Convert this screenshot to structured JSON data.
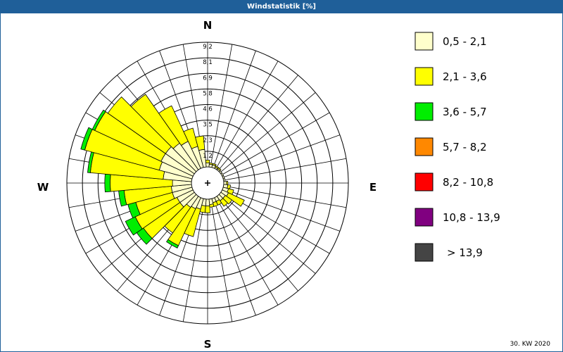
{
  "window": {
    "title": "Windstatistik [%]"
  },
  "footer": {
    "week": "30. KW 2020"
  },
  "chart_data": {
    "type": "wind-rose",
    "title": "Windstatistik [%]",
    "unit": "%",
    "directions": [
      "N",
      "E",
      "S",
      "W"
    ],
    "radial_ticks": [
      "1,2",
      "2,3",
      "3,5",
      "4,6",
      "5,8",
      "6,9",
      "8,1",
      "9,2"
    ],
    "rmax": 9.2,
    "sector_count": 36,
    "legend": [
      {
        "label": "0,5 - 2,1",
        "color": "#ffffcc"
      },
      {
        "label": "2,1 - 3,6",
        "color": "#ffff00"
      },
      {
        "label": "3,6 - 5,7",
        "color": "#00ee00"
      },
      {
        "label": "5,7 - 8,2",
        "color": "#ff8800"
      },
      {
        "label": "8,2 - 10,8",
        "color": "#ff0000"
      },
      {
        "label": "10,8 - 13,9",
        "color": "#800080"
      },
      {
        "label": "> 13,9",
        "color": "#444444"
      }
    ],
    "sectors": [
      {
        "dir": 0,
        "values": [
          0.3,
          0.2,
          0,
          0,
          0,
          0,
          0
        ]
      },
      {
        "dir": 10,
        "values": [
          0.2,
          0.1,
          0,
          0,
          0,
          0,
          0
        ]
      },
      {
        "dir": 20,
        "values": [
          0.2,
          0.1,
          0,
          0,
          0,
          0,
          0
        ]
      },
      {
        "dir": 30,
        "values": [
          0.1,
          0.1,
          0,
          0,
          0,
          0,
          0
        ]
      },
      {
        "dir": 40,
        "values": [
          0.1,
          0.1,
          0,
          0,
          0,
          0,
          0
        ]
      },
      {
        "dir": 50,
        "values": [
          0.1,
          0,
          0,
          0,
          0,
          0,
          0
        ]
      },
      {
        "dir": 60,
        "values": [
          0.1,
          0,
          0,
          0,
          0,
          0,
          0
        ]
      },
      {
        "dir": 70,
        "values": [
          0.1,
          0,
          0,
          0,
          0,
          0,
          0
        ]
      },
      {
        "dir": 80,
        "values": [
          0.1,
          0,
          0,
          0,
          0,
          0,
          0
        ]
      },
      {
        "dir": 90,
        "values": [
          0.2,
          0.1,
          0,
          0,
          0,
          0,
          0
        ]
      },
      {
        "dir": 100,
        "values": [
          0.3,
          0.2,
          0,
          0,
          0,
          0,
          0
        ]
      },
      {
        "dir": 110,
        "values": [
          0.4,
          0.4,
          0,
          0,
          0,
          0,
          0
        ]
      },
      {
        "dir": 120,
        "values": [
          0.5,
          1.3,
          0,
          0,
          0,
          0,
          0
        ]
      },
      {
        "dir": 130,
        "values": [
          0.4,
          0.6,
          0,
          0,
          0,
          0,
          0
        ]
      },
      {
        "dir": 140,
        "values": [
          0.4,
          0.5,
          0,
          0,
          0,
          0,
          0
        ]
      },
      {
        "dir": 150,
        "values": [
          0.3,
          0.3,
          0,
          0,
          0,
          0,
          0
        ]
      },
      {
        "dir": 160,
        "values": [
          0.3,
          0.3,
          0,
          0,
          0,
          0,
          0
        ]
      },
      {
        "dir": 170,
        "values": [
          0.4,
          0.2,
          0,
          0,
          0,
          0,
          0
        ]
      },
      {
        "dir": 180,
        "values": [
          0.5,
          0.5,
          0,
          0,
          0,
          0,
          0
        ]
      },
      {
        "dir": 190,
        "values": [
          0.5,
          0.5,
          0,
          0,
          0,
          0,
          0
        ]
      },
      {
        "dir": 200,
        "values": [
          0.8,
          2.1,
          0,
          0,
          0,
          0,
          0
        ]
      },
      {
        "dir": 210,
        "values": [
          0.9,
          3.0,
          0.2,
          0,
          0,
          0,
          0
        ]
      },
      {
        "dir": 220,
        "values": [
          1.0,
          2.3,
          0,
          0,
          0,
          0,
          0
        ]
      },
      {
        "dir": 230,
        "values": [
          1.3,
          3.3,
          0.6,
          0,
          0,
          0,
          0
        ]
      },
      {
        "dir": 240,
        "values": [
          1.3,
          3.4,
          0.8,
          0,
          0,
          0,
          0
        ]
      },
      {
        "dir": 250,
        "values": [
          1.5,
          2.8,
          0.6,
          0,
          0,
          0,
          0
        ]
      },
      {
        "dir": 260,
        "values": [
          1.5,
          3.5,
          0.4,
          0,
          0,
          0,
          0
        ]
      },
      {
        "dir": 270,
        "values": [
          1.4,
          4.6,
          0.4,
          0,
          0,
          0,
          0
        ]
      },
      {
        "dir": 280,
        "values": [
          2.1,
          5.4,
          0.2,
          0,
          0,
          0,
          0
        ]
      },
      {
        "dir": 290,
        "values": [
          2.5,
          5.7,
          0.3,
          0,
          0,
          0,
          0
        ]
      },
      {
        "dir": 300,
        "values": [
          2.6,
          5.4,
          0.2,
          0,
          0,
          0,
          0
        ]
      },
      {
        "dir": 310,
        "values": [
          2.6,
          5.2,
          0,
          0,
          0,
          0,
          0
        ]
      },
      {
        "dir": 320,
        "values": [
          2.4,
          4.4,
          0,
          0,
          0,
          0,
          0
        ]
      },
      {
        "dir": 330,
        "values": [
          2.2,
          2.9,
          0,
          0,
          0,
          0,
          0
        ]
      },
      {
        "dir": 340,
        "values": [
          1.6,
          1.4,
          0,
          0,
          0,
          0,
          0
        ]
      },
      {
        "dir": 350,
        "values": [
          1.3,
          1.0,
          0,
          0,
          0,
          0,
          0
        ]
      }
    ]
  }
}
